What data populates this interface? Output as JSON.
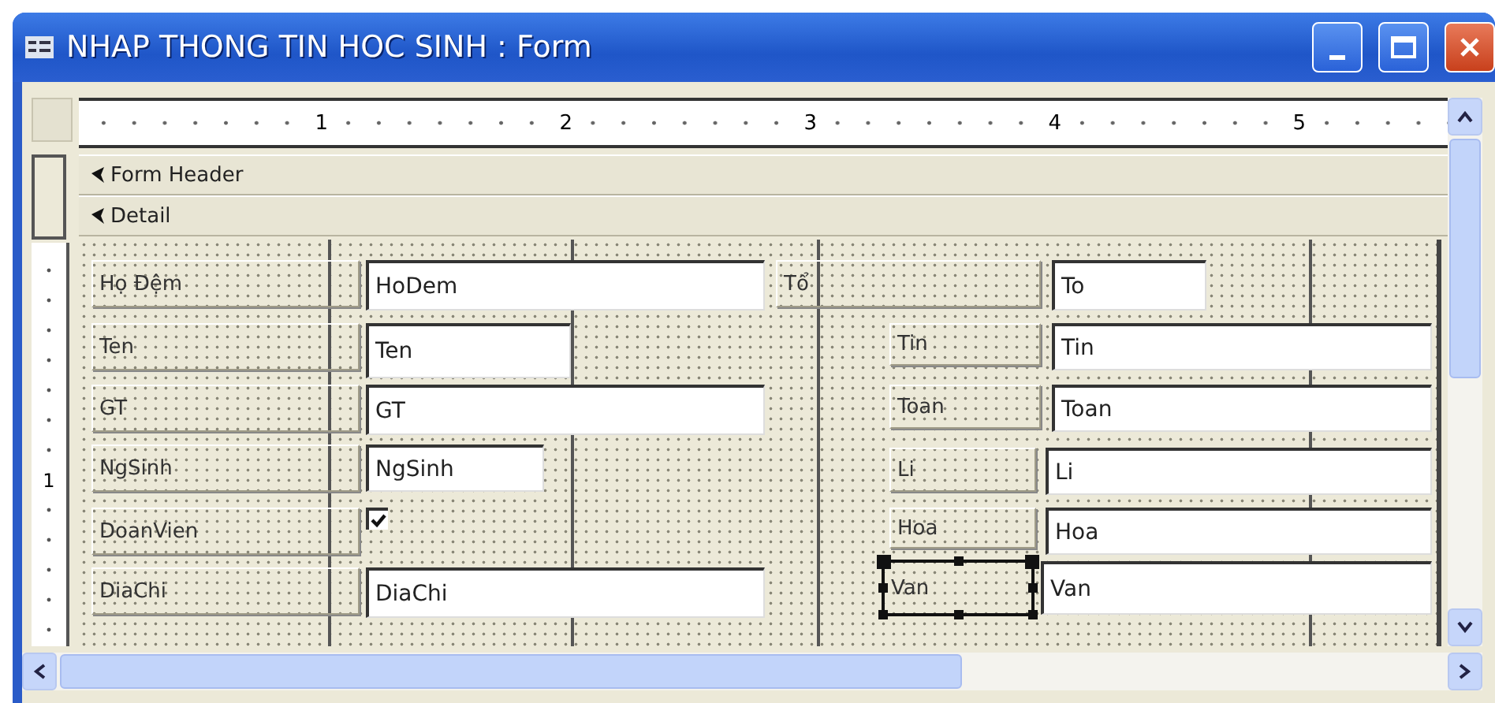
{
  "window": {
    "title": "NHAP THONG TIN HOC SINH : Form"
  },
  "ruler": {
    "marks": [
      "1",
      "2",
      "3",
      "4",
      "5"
    ]
  },
  "vertical_ruler": {
    "marks": [
      "1"
    ]
  },
  "sections": [
    {
      "label": "Form Header"
    },
    {
      "label": "Detail"
    }
  ],
  "fields": [
    {
      "label": "Họ Đệm",
      "kind": "text",
      "value": "HoDem",
      "selected": false
    },
    {
      "label": "Tổ",
      "kind": "text",
      "value": "To",
      "selected": false
    },
    {
      "label": "Ten",
      "kind": "text",
      "value": "Ten",
      "selected": false
    },
    {
      "label": "Tin",
      "kind": "text",
      "value": "Tin",
      "selected": false
    },
    {
      "label": "GT",
      "kind": "text",
      "value": "GT",
      "selected": false
    },
    {
      "label": "Toan",
      "kind": "text",
      "value": "Toan",
      "selected": false
    },
    {
      "label": "NgSinh",
      "kind": "text",
      "value": "NgSinh",
      "selected": false
    },
    {
      "label": "Li",
      "kind": "text",
      "value": "Li",
      "selected": false
    },
    {
      "label": "DoanVien",
      "kind": "checkbox",
      "checked": true,
      "selected": false
    },
    {
      "label": "Hoa",
      "kind": "text",
      "value": "Hoa",
      "selected": false
    },
    {
      "label": "DiaChi",
      "kind": "text",
      "value": "DiaChi",
      "selected": false
    },
    {
      "label": "Van",
      "kind": "text",
      "value": "Van",
      "selected": true
    }
  ]
}
